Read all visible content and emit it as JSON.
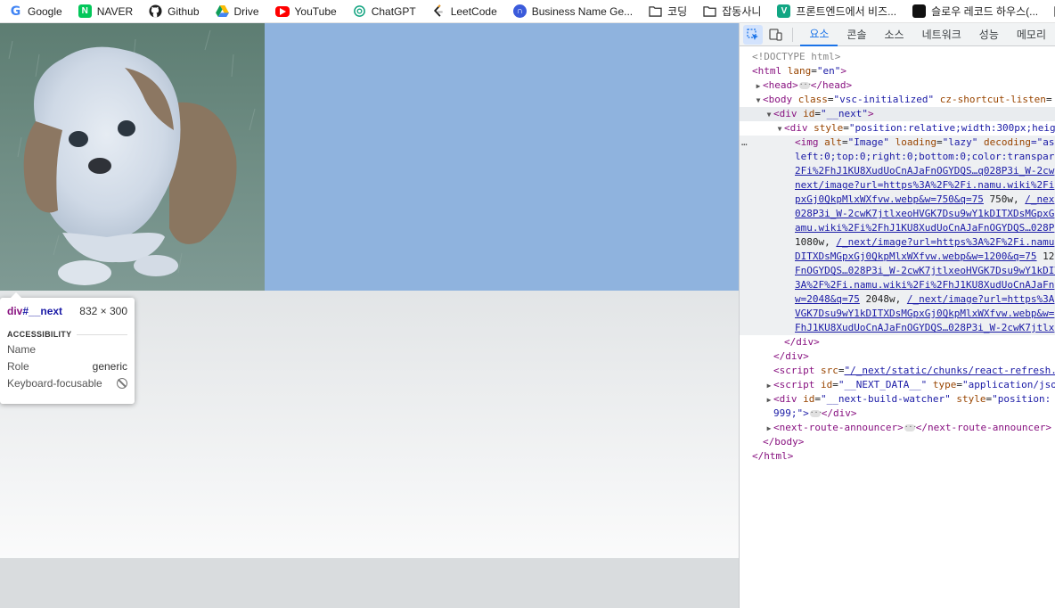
{
  "bookmarks": [
    {
      "label": "Google",
      "icon": "google-icon"
    },
    {
      "label": "NAVER",
      "icon": "naver-icon"
    },
    {
      "label": "Github",
      "icon": "github-icon"
    },
    {
      "label": "Drive",
      "icon": "drive-icon"
    },
    {
      "label": "YouTube",
      "icon": "youtube-icon"
    },
    {
      "label": "ChatGPT",
      "icon": "chatgpt-icon"
    },
    {
      "label": "LeetCode",
      "icon": "leetcode-icon"
    },
    {
      "label": "Business Name Ge...",
      "icon": "business-name-icon"
    },
    {
      "label": "코딩",
      "icon": "folder-icon"
    },
    {
      "label": "잡동사니",
      "icon": "folder-icon"
    },
    {
      "label": "프론트엔드에서 비즈...",
      "icon": "v-icon"
    },
    {
      "label": "슬로우 레코드 하우스(...",
      "icon": "record-icon"
    }
  ],
  "tooltip": {
    "tag": "div",
    "id": "#__next",
    "size": "832 × 300",
    "section": "ACCESSIBILITY",
    "rows": [
      {
        "label": "Name",
        "value": ""
      },
      {
        "label": "Role",
        "value": "generic"
      },
      {
        "label": "Keyboard-focusable",
        "value": ""
      }
    ]
  },
  "devtools": {
    "tabs": [
      "요소",
      "콘솔",
      "소스",
      "네트워크",
      "성능",
      "메모리"
    ],
    "active_tab": "요소",
    "dom": {
      "doctype": "<!DOCTYPE html>",
      "html_open": {
        "tag": "<html",
        "attr": "lang",
        "val": "\"en\"",
        "close": ">"
      },
      "head": {
        "open": "<head>",
        "close": "</head>"
      },
      "body": {
        "tag": "<body",
        "attr1": "class",
        "val1": "\"vsc-initialized\"",
        "attr2": "cz-shortcut-listen",
        "val2": "="
      },
      "next_div": {
        "tag": "<div",
        "attr": "id",
        "val": "\"__next\"",
        "close": ">"
      },
      "style_div": {
        "tag": "<div",
        "attr": "style",
        "val": "\"position:relative;width:300px;heig"
      },
      "img": {
        "tag": "<img",
        "a1": "alt",
        "v1": "\"Image\"",
        "a2": "loading",
        "v2": "\"lazy\"",
        "a3": "decoding",
        "v3": "=\"as"
      },
      "img_lines": [
        "left:0;top:0;right:0;bottom:0;color:transpar",
        "2Fi%2FhJ1KU8XudUoCnAJaFnOGYDQS…q028P3i_W-2cw",
        "next/image?url=https%3A%2F%2Fi.namu.wiki%2Fi",
        "pxGj0QkpMlxWXfvw.webp&w=750&q=75",
        "750w,",
        "/_nex",
        "028P3i_W-2cwK7jtlxeoHVGK7Dsu9wY1kDITXDsMGpxG",
        "amu.wiki%2Fi%2FhJ1KU8XudUoCnAJaFnOGYDQS…028P",
        "1080w,",
        "/_next/image?url=https%3A%2F%2Fi.namu",
        "DITXDsMGpxGj0QkpMlxWXfvw.webp&w=1200&q=75",
        "12",
        "FnOGYDQS…028P3i_W-2cwK7jtlxeoHVGK7Dsu9wY1kDIT",
        "3A%2F%2Fi.namu.wiki%2Fi%2FhJ1KU8XudUoCnAJaFn",
        "w=2048&q=75",
        "2048w,",
        "/_next/image?url=https%3A",
        "VGK7Dsu9wY1kDITXDsMGpxGj0QkpMlxWXfvw.webp&w=",
        "FhJ1KU8XudUoCnAJaFnOGYDQS…028P3i_W-2cwK7jtlx"
      ],
      "close_div1": "</div>",
      "close_div2": "</div>",
      "script1": {
        "tag": "<script",
        "attr": "src",
        "val": "\"/_next/static/chunks/react-refresh."
      },
      "script2": {
        "tag": "<script",
        "attr1": "id",
        "val1": "\"__NEXT_DATA__\"",
        "attr2": "type",
        "val2": "\"application/jso"
      },
      "build_watcher": {
        "tag": "<div",
        "attr1": "id",
        "val1": "\"__next-build-watcher\"",
        "attr2": "style",
        "val2": "\"position:",
        "cont": "999;\">",
        "close": "</div>"
      },
      "route": {
        "open": "<next-route-announcer>",
        "close": "</next-route-announcer>"
      },
      "body_close": "</body>",
      "html_close": "</html>",
      "gutter": "…"
    }
  }
}
